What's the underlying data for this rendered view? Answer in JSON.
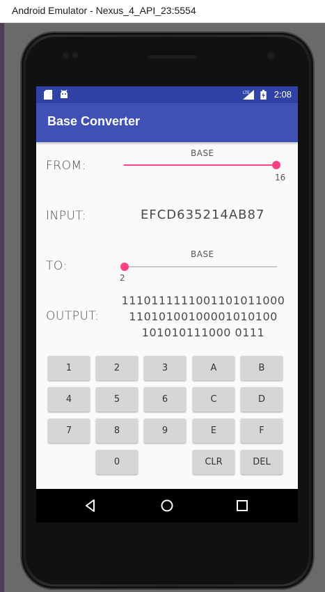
{
  "window": {
    "title": "Android Emulator - Nexus_4_API_23:5554"
  },
  "status_bar": {
    "time": "2:08",
    "network_label": "LTE"
  },
  "app": {
    "title": "Base Converter",
    "colors": {
      "primary": "#3f51b5",
      "primary_dark": "#3042a6",
      "accent": "#ff4081"
    }
  },
  "from": {
    "label": "FROM:",
    "slider_caption": "BASE",
    "base_value": "16",
    "slider_fraction": 1.0
  },
  "input": {
    "label": "INPUT:",
    "value": "EFCD635214AB87"
  },
  "to": {
    "label": "TO:",
    "slider_caption": "BASE",
    "base_value": "2",
    "slider_fraction": 0.0
  },
  "output": {
    "label": "OUTPUT:",
    "lines": [
      "1110111111001101011000",
      "11010100100001010100",
      "101010111000 0111"
    ]
  },
  "keypad": {
    "rows": [
      [
        "1",
        "2",
        "3",
        "A",
        "B"
      ],
      [
        "4",
        "5",
        "6",
        "C",
        "D"
      ],
      [
        "7",
        "8",
        "9",
        "E",
        "F"
      ],
      [
        "",
        "0",
        "",
        "CLR",
        "DEL"
      ]
    ]
  },
  "nav_bar": {
    "icons": [
      "back-icon",
      "home-icon",
      "recents-icon"
    ]
  }
}
